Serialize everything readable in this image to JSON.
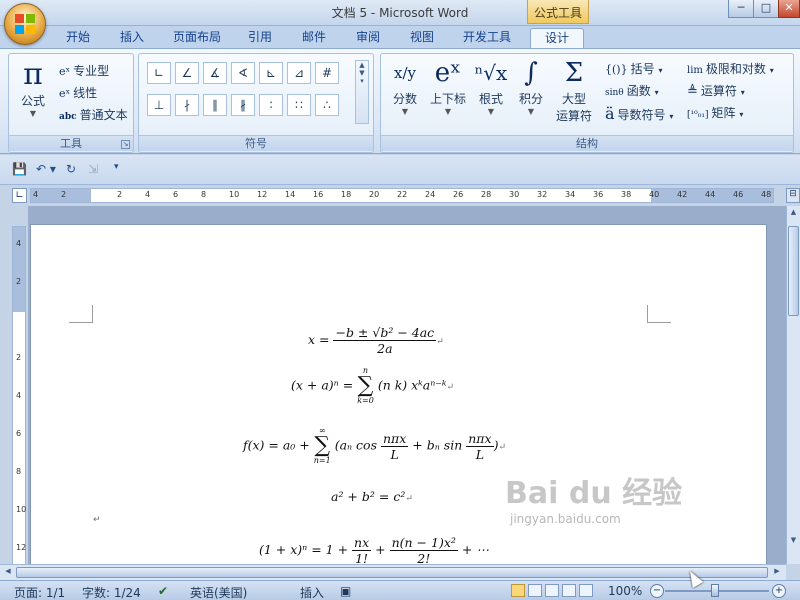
{
  "window": {
    "title": "文档 5 - Microsoft Word",
    "contextual_tab": "公式工具",
    "controls": {
      "minimize": "─",
      "maximize": "□",
      "close": "✕"
    }
  },
  "tabs": [
    {
      "label": "开始"
    },
    {
      "label": "插入"
    },
    {
      "label": "页面布局"
    },
    {
      "label": "引用"
    },
    {
      "label": "邮件"
    },
    {
      "label": "审阅"
    },
    {
      "label": "视图"
    },
    {
      "label": "开发工具"
    },
    {
      "label": "设计"
    }
  ],
  "ribbon": {
    "tools": {
      "label": "工具",
      "equation": {
        "glyph": "π",
        "label": "公式"
      },
      "professional": "专业型",
      "linear": "线性",
      "normal_text": "普通文本",
      "abc": "abc"
    },
    "symbols": {
      "label": "符号",
      "row1": [
        "∟",
        "∠",
        "∡",
        "∢",
        "⊾",
        "⊿",
        "#"
      ],
      "row2": [
        "⊥",
        "∤",
        "∥",
        "∦",
        "∶",
        "∷",
        "∴"
      ]
    },
    "structures": {
      "label": "结构",
      "fraction": {
        "glyph": "x/y",
        "label": "分数"
      },
      "script": {
        "glyph": "eˣ",
        "label": "上下标"
      },
      "radical": {
        "glyph": "ⁿ√x",
        "label": "根式"
      },
      "integral": {
        "glyph": "∫",
        "label": "积分"
      },
      "large_operator": {
        "glyph": "Σ",
        "label_line1": "大型",
        "label_line2": "运算符"
      },
      "bracket": {
        "glyph": "{()}",
        "label": "括号"
      },
      "function": {
        "glyph": "sinθ",
        "label": "函数"
      },
      "accent": {
        "glyph": "ä",
        "label": "导数符号"
      },
      "limit_log": {
        "glyph": "lim",
        "label": "极限和对数"
      },
      "operator": {
        "glyph": "≜",
        "label": "运算符"
      },
      "matrix": {
        "glyph": "[¹⁰₀₁]",
        "label": "矩阵"
      }
    }
  },
  "ruler": {
    "numbers": [
      "4",
      "2",
      "",
      "2",
      "4",
      "6",
      "8",
      "10",
      "12",
      "14",
      "16",
      "18",
      "20",
      "22",
      "24",
      "26",
      "28",
      "30",
      "32",
      "34",
      "36",
      "38",
      "40",
      "42",
      "44",
      "46",
      "48"
    ],
    "vnumbers": [
      "4",
      "2",
      "",
      "2",
      "4",
      "6",
      "8",
      "10",
      "12"
    ]
  },
  "document": {
    "eq1": {
      "lhs": "x =",
      "num": "−b ± √b² − 4ac",
      "den": "2a"
    },
    "eq2": {
      "lhs": "(x + a)ⁿ =",
      "top": "n",
      "bottom": "k=0",
      "rhs": "(n k) xᵏaⁿ⁻ᵏ"
    },
    "eq3": {
      "lhs": "f(x) = a₀ +",
      "top": "∞",
      "bottom": "n=1",
      "body1": "(aₙ cos",
      "frac1_num": "nπx",
      "frac1_den": "L",
      "body2": "+ bₙ sin",
      "frac2_num": "nπx",
      "frac2_den": "L",
      "body3": ")"
    },
    "eq4": "a² + b² = c²",
    "eq5": {
      "lhs": "(1 + x)ⁿ = 1 +",
      "frac1_num": "nx",
      "frac1_den": "1!",
      "plus": "+",
      "frac2_num": "n(n − 1)x²",
      "frac2_den": "2!",
      "tail": "+ ⋯"
    },
    "para_mark": "↵"
  },
  "watermark": {
    "main": "Bai du 经验",
    "sub": "jingyan.baidu.com"
  },
  "status": {
    "page": "页面: 1/1",
    "words": "字数: 1/24",
    "language": "英语(美国)",
    "mode": "插入",
    "zoom": "100%",
    "zoom_fraction": 0.5
  },
  "colors": {
    "ribbon_accent": "#15428b",
    "contextual_tab": "#f0c95d"
  }
}
